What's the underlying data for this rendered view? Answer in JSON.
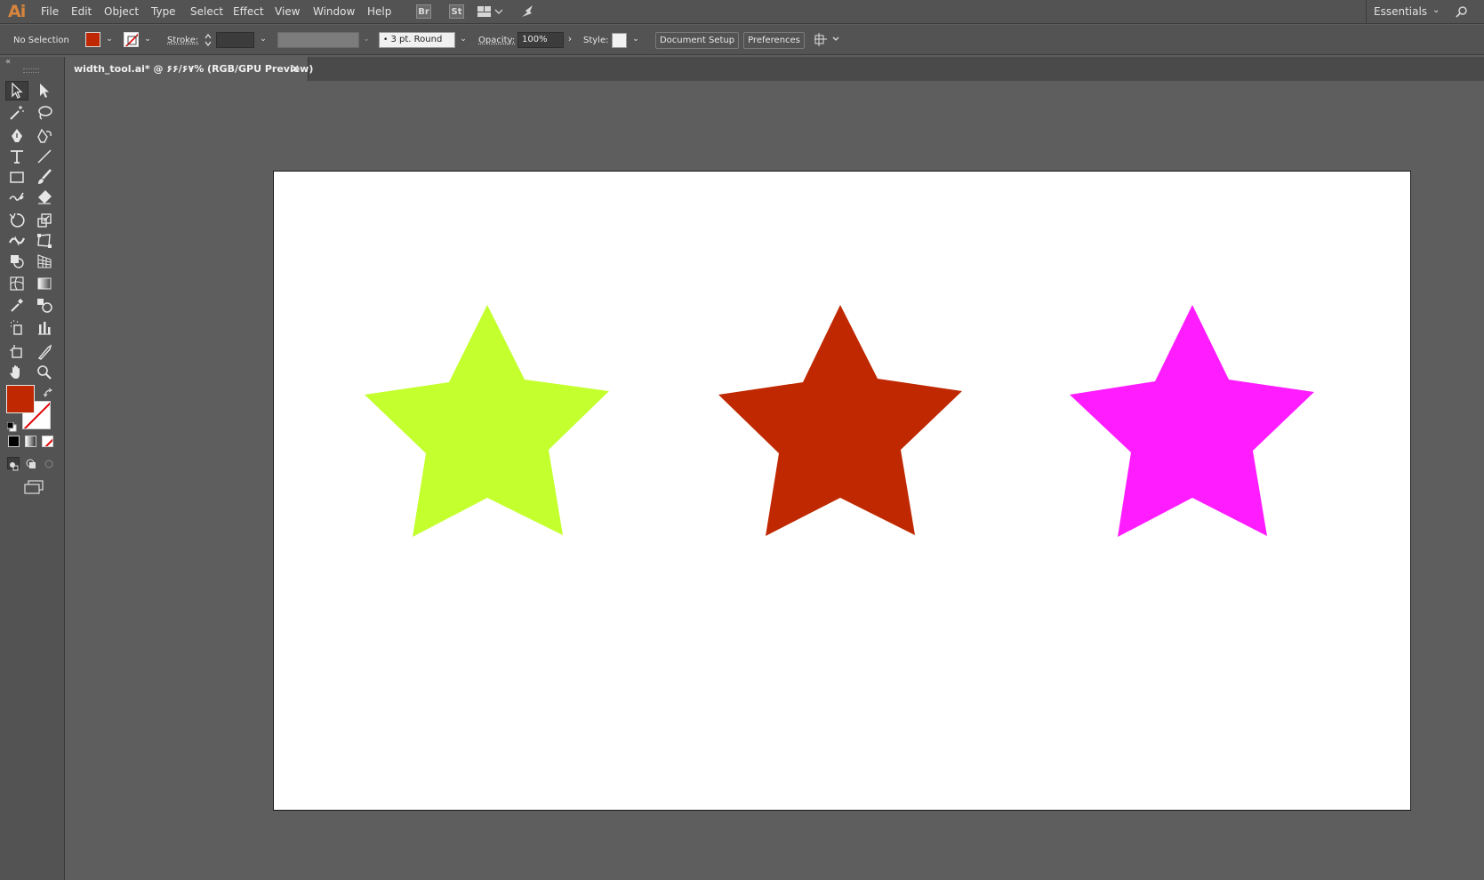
{
  "app": {
    "logo": "Ai"
  },
  "menu": [
    "File",
    "Edit",
    "Object",
    "Type",
    "Select",
    "Effect",
    "View",
    "Window",
    "Help"
  ],
  "bridge_buttons": [
    "Br",
    "St"
  ],
  "workspace": {
    "label": "Essentials"
  },
  "control_bar": {
    "selection": "No Selection",
    "fill_color": "#bf2800",
    "stroke_label": "Stroke:",
    "brush": "3 pt. Round",
    "opacity_label": "Opacity:",
    "opacity_value": "100%",
    "style_label": "Style:",
    "document_setup": "Document Setup",
    "preferences": "Preferences"
  },
  "document_tab": {
    "title": "width_tool.ai* @ ۶۶/۶۷% (RGB/GPU Preview)",
    "close": "×"
  },
  "tools": [
    "selection-tool",
    "direct-selection-tool",
    "magic-wand-tool",
    "lasso-tool",
    "pen-tool",
    "curvature-tool",
    "type-tool",
    "line-segment-tool",
    "rectangle-tool",
    "paintbrush-tool",
    "shaper-tool",
    "eraser-tool",
    "rotate-tool",
    "scale-tool",
    "width-tool",
    "free-transform-tool",
    "shape-builder-tool",
    "perspective-grid-tool",
    "mesh-tool",
    "gradient-tool",
    "eyedropper-tool",
    "blend-tool",
    "symbol-sprayer-tool",
    "column-graph-tool",
    "artboard-tool",
    "slice-tool",
    "hand-tool",
    "zoom-tool"
  ],
  "fill_stroke": {
    "fill": "#bf2800",
    "stroke": "none"
  },
  "stars": [
    {
      "name": "star-yellow-green",
      "color": "#c4ff2e"
    },
    {
      "name": "star-red",
      "color": "#bf2800"
    },
    {
      "name": "star-magenta",
      "color": "#ff1cff"
    }
  ]
}
